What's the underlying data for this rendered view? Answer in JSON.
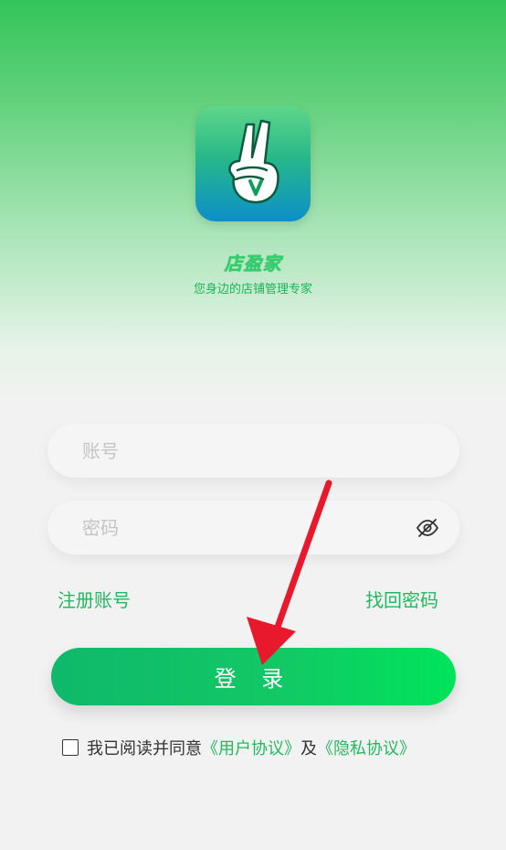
{
  "brand": {
    "name": "店盈家",
    "slogan": "您身边的店铺管理专家"
  },
  "form": {
    "account_placeholder": "账号",
    "password_placeholder": "密码"
  },
  "links": {
    "register": "注册账号",
    "recover": "找回密码"
  },
  "login_button": "登 录",
  "agreement": {
    "prefix": "我已阅读并同意",
    "user_agreement": "《用户协议》",
    "and": "及",
    "privacy_agreement": "《隐私协议》",
    "checked": false
  },
  "colors": {
    "accent": "#22b85f",
    "button_start": "#0fb86a",
    "button_end": "#00e45a",
    "annotation_arrow": "#e8192c"
  },
  "icons": {
    "logo": "peace-hand-v-icon",
    "password_toggle": "eye-off-icon"
  }
}
